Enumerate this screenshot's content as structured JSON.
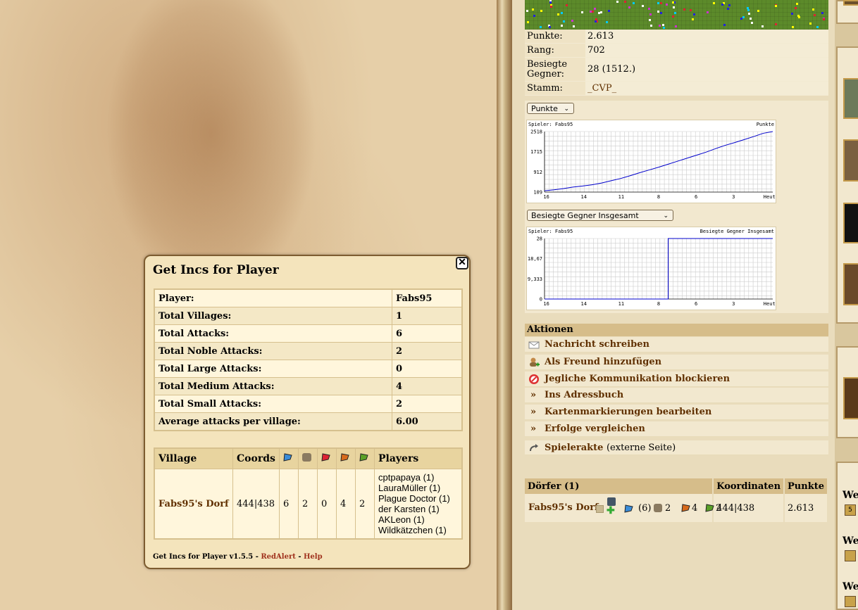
{
  "player_info": {
    "rows": [
      {
        "label": "Punkte:",
        "value": "2.613"
      },
      {
        "label": "Rang:",
        "value": "702"
      },
      {
        "label": "Besiegte Gegner:",
        "value": "28 (1512.)"
      },
      {
        "label": "Stamm:",
        "value": "_CVP_"
      }
    ]
  },
  "charts": {
    "points_select": "Punkte",
    "defeated_select": "Besiegte Gegner Insgesamt"
  },
  "chart_data": [
    {
      "type": "line",
      "title": "Punkte",
      "subtitle": "Spieler: Fabs95",
      "categories": [
        "16",
        "14",
        "11",
        "8",
        "6",
        "3",
        "Heute"
      ],
      "yticks": [
        "109",
        "912",
        "1715",
        "2518"
      ],
      "ylim": [
        109,
        2518
      ],
      "series": [
        {
          "values": [
            160,
            200,
            250,
            310,
            350,
            400,
            470,
            560,
            650,
            760,
            880,
            990,
            1100,
            1220,
            1340,
            1460,
            1580,
            1700,
            1840,
            1970,
            2080,
            2200,
            2320,
            2450,
            2518
          ]
        }
      ],
      "grid": true,
      "color": "#0000cc"
    },
    {
      "type": "line",
      "title": "Besiegte Gegner Insgesamt",
      "subtitle": "Spieler: Fabs95",
      "categories": [
        "16",
        "14",
        "11",
        "8",
        "6",
        "3",
        "Heute"
      ],
      "yticks": [
        "0",
        "9,333",
        "18,67",
        "28"
      ],
      "ylim": [
        0,
        28
      ],
      "series": [
        {
          "values": [
            0,
            0,
            0,
            0,
            0,
            0,
            0,
            0,
            0,
            0,
            0,
            0,
            0,
            28,
            28,
            28,
            28,
            28,
            28,
            28,
            28,
            28,
            28,
            28,
            28
          ]
        }
      ],
      "grid": true,
      "color": "#0000cc"
    }
  ],
  "actions": {
    "header": "Aktionen",
    "items": [
      {
        "label": "Nachricht schreiben",
        "icon": "envelope-icon"
      },
      {
        "label": "Als Freund hinzufügen",
        "icon": "add-friend-icon"
      },
      {
        "label": "Jegliche Kommunikation blockieren",
        "icon": "block-icon"
      },
      {
        "label": "Ins Adressbuch",
        "icon": "raquo"
      },
      {
        "label": "Kartenmarkierungen bearbeiten",
        "icon": "raquo"
      },
      {
        "label": "Erfolge vergleichen",
        "icon": "raquo"
      }
    ],
    "external": {
      "label": "Spielerakte",
      "note": "(externe Seite)"
    }
  },
  "villages": {
    "headers": [
      "Dörfer (1)",
      "Koordinaten",
      "Punkte"
    ],
    "rows": [
      {
        "name": "Fabs95's Dorf",
        "incs": "(6)",
        "c1": "2",
        "c2": "4",
        "c3": "2",
        "coords": "444|438",
        "points": "2.613"
      }
    ]
  },
  "side": {
    "labels": [
      "We",
      "We",
      "We"
    ],
    "badge": "5"
  },
  "popup": {
    "title": "Get Incs for Player",
    "stats": [
      {
        "label": "Player:",
        "value": "Fabs95"
      },
      {
        "label": "Total Villages:",
        "value": "1"
      },
      {
        "label": "Total Attacks:",
        "value": "6"
      },
      {
        "label": "Total Noble Attacks:",
        "value": "2"
      },
      {
        "label": "Total Large Attacks:",
        "value": "0"
      },
      {
        "label": "Total Medium Attacks:",
        "value": "4"
      },
      {
        "label": "Total Small Attacks:",
        "value": "2"
      },
      {
        "label": "Average attacks per village:",
        "value": "6.00"
      }
    ],
    "table_headers": {
      "village": "Village",
      "coords": "Coords",
      "players": "Players"
    },
    "row": {
      "village": "Fabs95's Dorf",
      "coords": "444|438",
      "counts": [
        "6",
        "2",
        "0",
        "4",
        "2"
      ],
      "players": [
        "cptpapaya (1)",
        "LauraMüller (1)",
        "Plague Doctor (1)",
        "der Karsten (1)",
        "AKLeon (1)",
        "Wildkätzchen (1)"
      ]
    },
    "footer": {
      "version": "Get Incs for Player v1.5.5",
      "sep1": " - ",
      "author": "RedAlert",
      "sep2": " - ",
      "help": "Help"
    }
  }
}
